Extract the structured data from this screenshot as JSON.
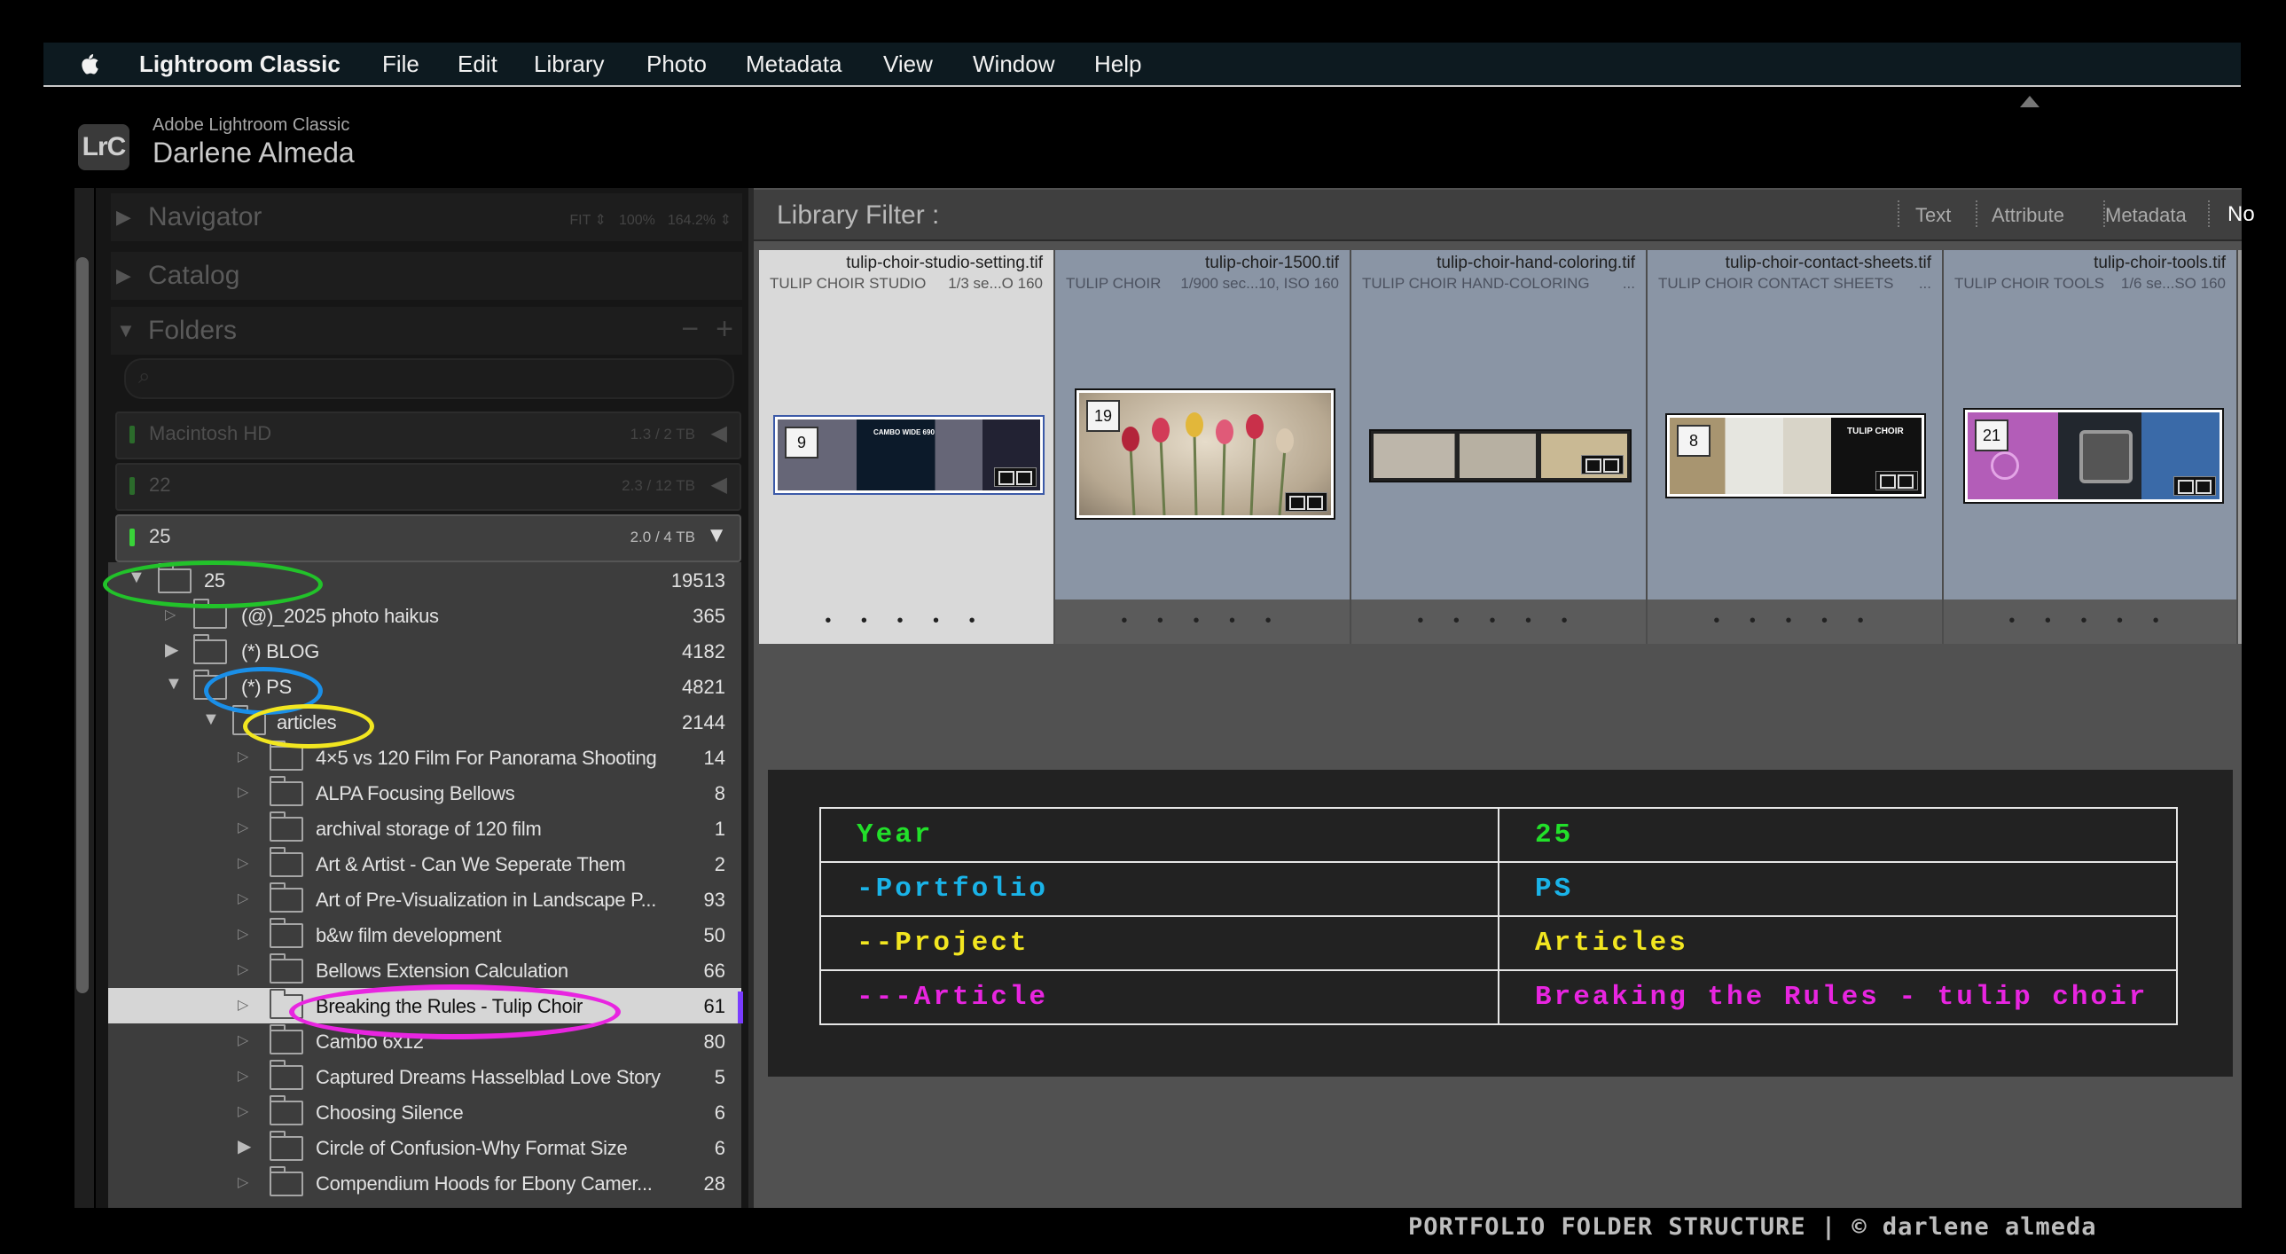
{
  "menu": {
    "app_name": "Lightroom Classic",
    "items": [
      "File",
      "Edit",
      "Library",
      "Photo",
      "Metadata",
      "View",
      "Window",
      "Help"
    ]
  },
  "identity": {
    "logo_text": "LrC",
    "product": "Adobe Lightroom Classic",
    "user": "Darlene Almeda"
  },
  "left_panel": {
    "navigator": {
      "title": "Navigator",
      "opts": [
        "FIT ⇕",
        "100%",
        "164.2% ⇕"
      ]
    },
    "catalog": {
      "title": "Catalog"
    },
    "folders": {
      "title": "Folders",
      "minus": "−",
      "plus": "+"
    },
    "volumes": [
      {
        "name": "Macintosh HD",
        "size": "1.3 / 2 TB"
      },
      {
        "name": "22",
        "size": "2.3 / 12 TB"
      },
      {
        "name": "25",
        "size": "2.0 / 4 TB"
      }
    ]
  },
  "folder_tree": [
    {
      "label": "25",
      "count": "19513"
    },
    {
      "label": "(@)_2025 photo haikus",
      "count": "365"
    },
    {
      "label": "(*) BLOG",
      "count": "4182"
    },
    {
      "label": "(*) PS",
      "count": "4821"
    },
    {
      "label": "articles",
      "count": "2144"
    },
    {
      "label": "4×5 vs 120 Film For Panorama Shooting",
      "count": "14"
    },
    {
      "label": "ALPA Focusing Bellows",
      "count": "8"
    },
    {
      "label": "archival storage of 120 film",
      "count": "1"
    },
    {
      "label": "Art & Artist - Can We Seperate Them",
      "count": "2"
    },
    {
      "label": "Art of Pre-Visualization in Landscape P...",
      "count": "93"
    },
    {
      "label": "b&w film development",
      "count": "50"
    },
    {
      "label": "Bellows Extension Calculation",
      "count": "66"
    },
    {
      "label": "Breaking the Rules - Tulip Choir",
      "count": "61"
    },
    {
      "label": "Cambo 6x12",
      "count": "80"
    },
    {
      "label": "Captured Dreams Hasselblad Love Story",
      "count": "5"
    },
    {
      "label": "Choosing Silence",
      "count": "6"
    },
    {
      "label": "Circle of Confusion-Why Format Size",
      "count": "6"
    },
    {
      "label": "Compendium Hoods for Ebony Camer...",
      "count": "28"
    }
  ],
  "library_filter": {
    "label": "Library Filter :",
    "options": [
      "Text",
      "Attribute",
      "Metadata",
      "No"
    ]
  },
  "filmstrip": [
    {
      "filename": "tulip-choir-studio-setting.tif",
      "title": "TULIP CHOIR STUDIO",
      "exif": "1/3 se...O 160",
      "badge": "9",
      "dots": "• • • • •",
      "thumb_caption": "CAMBO WIDE 690"
    },
    {
      "filename": "tulip-choir-1500.tif",
      "title": "TULIP CHOIR",
      "exif": "1/900 sec...10, ISO 160",
      "badge": "19",
      "dots": "• • • • •",
      "thumb_caption": ""
    },
    {
      "filename": "tulip-choir-hand-coloring.tif",
      "title": "TULIP CHOIR HAND-COLORING",
      "exif": "...",
      "badge": "",
      "dots": "• • • • •",
      "thumb_caption": ""
    },
    {
      "filename": "tulip-choir-contact-sheets.tif",
      "title": "TULIP CHOIR CONTACT SHEETS",
      "exif": "...",
      "badge": "8",
      "dots": "• • • • •",
      "thumb_caption": "TULIP CHOIR"
    },
    {
      "filename": "tulip-choir-tools.tif",
      "title": "TULIP CHOIR TOOLS",
      "exif": "1/6 se...SO 160",
      "badge": "21",
      "dots": "• • • • •",
      "thumb_caption": ""
    }
  ],
  "structure_table": {
    "rows": [
      {
        "key": "Year",
        "value": "25",
        "color": "#22e02a"
      },
      {
        "key": "-Portfolio",
        "value": "PS",
        "color": "#1ab3e8"
      },
      {
        "key": "--Project",
        "value": "Articles",
        "color": "#f2e620"
      },
      {
        "key": "---Article",
        "value": "Breaking the Rules - tulip choir",
        "color": "#e825e0"
      }
    ]
  },
  "caption": "PORTFOLIO FOLDER STRUCTURE | © darlene almeda",
  "colors": {
    "green_highlight": "#22c22a",
    "blue_highlight": "#1a8fe8",
    "yellow_highlight": "#f2e620",
    "magenta_highlight": "#e825e0",
    "selection_mark": "#7a3cff"
  }
}
